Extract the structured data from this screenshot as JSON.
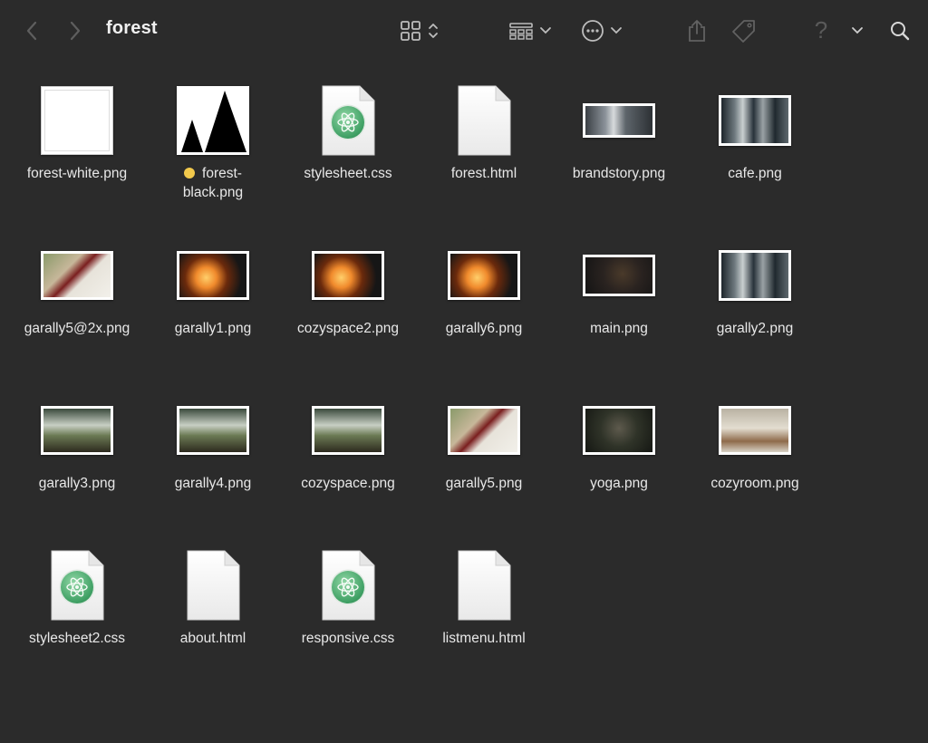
{
  "window": {
    "title": "forest",
    "toolbar": {
      "back": "back-chevron",
      "forward": "forward-chevron",
      "icon_view": "grid-icon",
      "group": "list-group-icon",
      "more": "ellipsis-circle-icon",
      "share": "share-icon",
      "tags": "tag-icon",
      "help": "?",
      "search": "magnifier-icon"
    }
  },
  "files": [
    {
      "name": "forest-white.png",
      "kind": "white-image"
    },
    {
      "name": "forest-black.png",
      "kind": "black-mountains",
      "tag_color": "#f2c94c",
      "label_line1": "forest-",
      "label_line2": "black.png"
    },
    {
      "name": "stylesheet.css",
      "kind": "css"
    },
    {
      "name": "forest.html",
      "kind": "html"
    },
    {
      "name": "brandstory.png",
      "kind": "photo-brandstory"
    },
    {
      "name": "cafe.png",
      "kind": "photo-cafe"
    },
    {
      "name": "garally5@2x.png",
      "kind": "photo-jar"
    },
    {
      "name": "garally1.png",
      "kind": "photo-fire"
    },
    {
      "name": "cozyspace2.png",
      "kind": "photo-fire"
    },
    {
      "name": "garally6.png",
      "kind": "photo-fire"
    },
    {
      "name": "main.png",
      "kind": "photo-main"
    },
    {
      "name": "garally2.png",
      "kind": "photo-cafe"
    },
    {
      "name": "garally3.png",
      "kind": "photo-trees"
    },
    {
      "name": "garally4.png",
      "kind": "photo-trees"
    },
    {
      "name": "cozyspace.png",
      "kind": "photo-trees"
    },
    {
      "name": "garally5.png",
      "kind": "photo-jar"
    },
    {
      "name": "yoga.png",
      "kind": "photo-yoga"
    },
    {
      "name": "cozyroom.png",
      "kind": "photo-room"
    },
    {
      "name": "stylesheet2.css",
      "kind": "css"
    },
    {
      "name": "about.html",
      "kind": "html"
    },
    {
      "name": "responsive.css",
      "kind": "css"
    },
    {
      "name": "listmenu.html",
      "kind": "html"
    }
  ]
}
